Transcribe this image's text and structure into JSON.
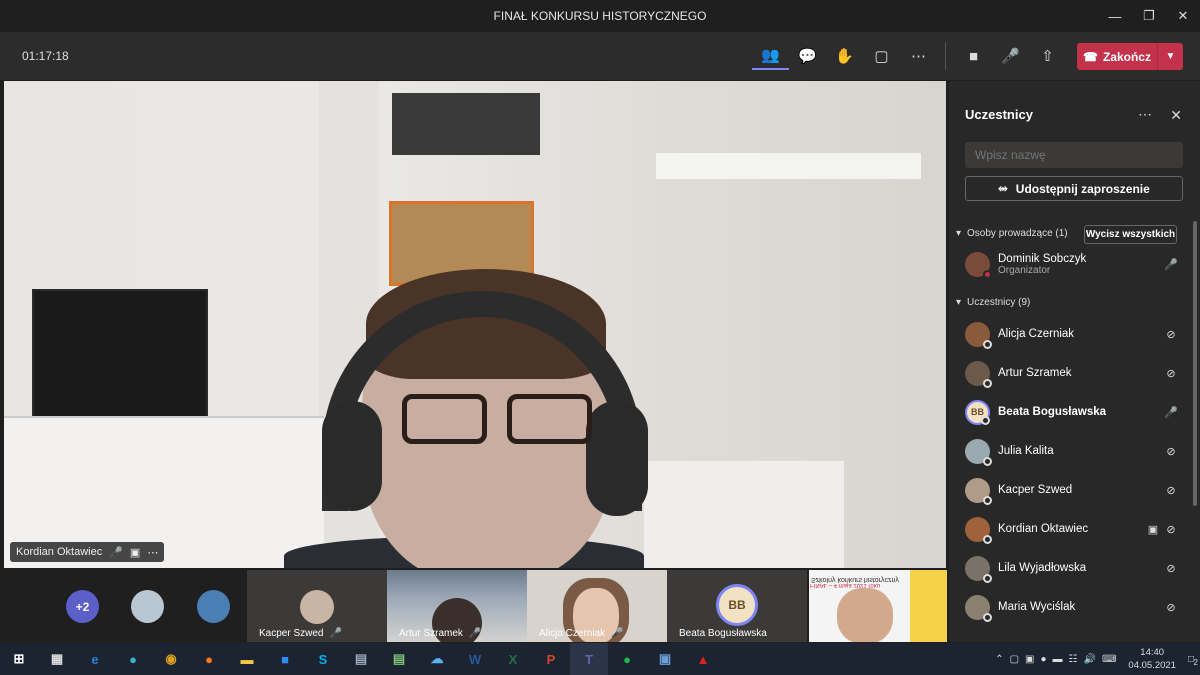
{
  "window": {
    "title": "FINAŁ KONKURSU HISTORYCZNEGO"
  },
  "toolbar": {
    "timer": "01:17:18",
    "leave_label": "Zakończ"
  },
  "video": {
    "speaker_name": "Kordian Oktawiec"
  },
  "strip": {
    "overflow_count": "+2",
    "tiles": [
      {
        "name": "Kacper Szwed"
      },
      {
        "name": "Artur Szramek"
      },
      {
        "name": "Alicja Czerniak"
      },
      {
        "name": "Beata Bogusławska",
        "initials": "BB"
      }
    ],
    "content_share": {
      "line1": "Szkolny konkurs historyczny",
      "line2": "FINAŁ – 4 maja 2021 roku"
    }
  },
  "panel": {
    "title": "Uczestnicy",
    "search_placeholder": "Wpisz nazwę",
    "share_label": "Udostępnij zaproszenie",
    "presenters_header": "Osoby prowadzące (1)",
    "mute_all_label": "Wycisz wszystkich",
    "presenter": {
      "name": "Dominik Sobczyk",
      "role": "Organizator"
    },
    "attendees_header": "Uczestnicy (9)",
    "attendees": [
      {
        "name": "Alicja Czerniak",
        "color": "#8a5a3c"
      },
      {
        "name": "Artur Szramek",
        "color": "#6b5a4a"
      },
      {
        "name": "Beata Bogusławska",
        "initials": "BB",
        "color": "#f2e2c4"
      },
      {
        "name": "Julia Kalita",
        "color": "#9aa8b0"
      },
      {
        "name": "Kacper Szwed",
        "color": "#b09a88"
      },
      {
        "name": "Kordian Oktawiec",
        "color": "#a0623a"
      },
      {
        "name": "Lila Wyjadłowska",
        "color": "#7a7268"
      },
      {
        "name": "Maria Wyciślak",
        "color": "#8a8070"
      }
    ]
  },
  "taskbar": {
    "time": "14:40",
    "date": "04.05.2021",
    "notifications": "2"
  }
}
